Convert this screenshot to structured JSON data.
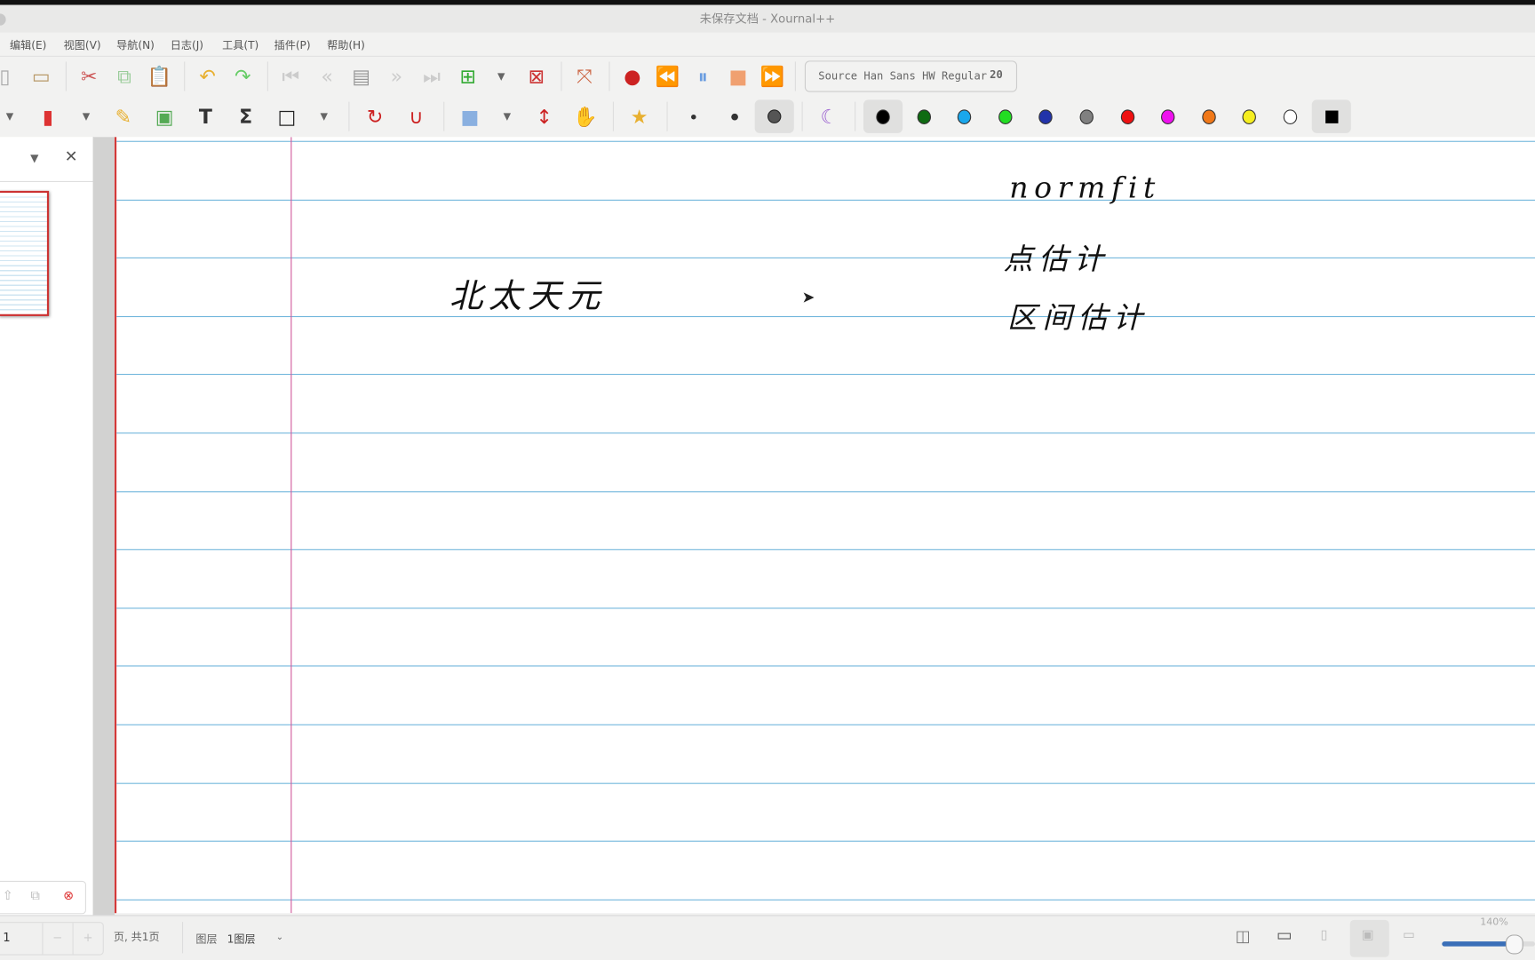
{
  "window": {
    "title": "未保存文档 - Xournal++"
  },
  "menu": [
    {
      "label": "编辑(E)"
    },
    {
      "label": "视图(V)"
    },
    {
      "label": "导航(N)"
    },
    {
      "label": "日志(J)"
    },
    {
      "label": "工具(T)"
    },
    {
      "label": "插件(P)"
    },
    {
      "label": "帮助(H)"
    }
  ],
  "toolbar": {
    "font_name": "Source Han Sans HW Regular",
    "font_size": "20"
  },
  "colors": [
    "#000000",
    "#0f6b12",
    "#1aa7ec",
    "#22dd22",
    "#2233aa",
    "#808080",
    "#ee1111",
    "#ee11ee",
    "#f07818",
    "#f5ee20",
    "#ffffff"
  ],
  "selected_color": "#000000",
  "canvas": {
    "handwriting": [
      "北太天元",
      "normfit",
      "点估计",
      "区间估计"
    ]
  },
  "statusbar": {
    "page": "1",
    "page_of": "页, 共1页",
    "layer_label": "图层",
    "layer_value": "1图层",
    "zoom": "140%"
  },
  "zoom_level_percent": 140
}
